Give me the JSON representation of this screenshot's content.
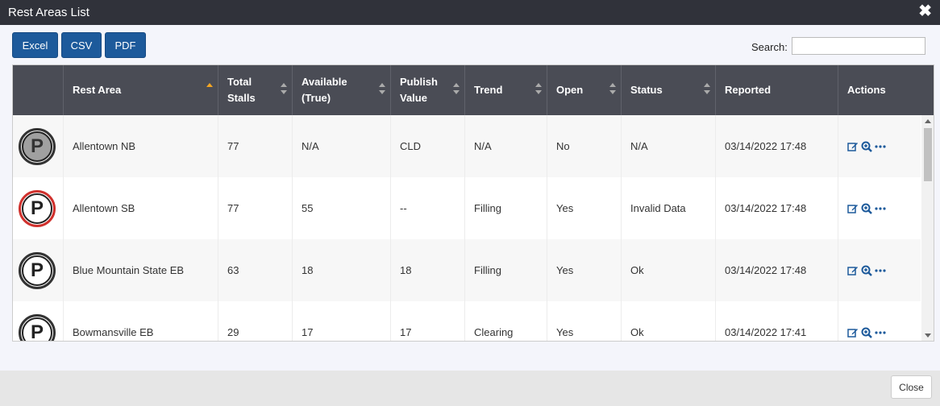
{
  "window": {
    "title": "Rest Areas List"
  },
  "toolbar": {
    "excel": "Excel",
    "csv": "CSV",
    "pdf": "PDF"
  },
  "search": {
    "label": "Search:",
    "value": ""
  },
  "table": {
    "headers": {
      "rest_area": "Rest Area",
      "total_stalls_1": "Total",
      "total_stalls_2": "Stalls",
      "available_1": "Available",
      "available_2": "(True)",
      "publish_1": "Publish",
      "publish_2": "Value",
      "trend": "Trend",
      "open": "Open",
      "status": "Status",
      "reported": "Reported",
      "actions": "Actions"
    },
    "sorted_column": "rest_area",
    "rows": [
      {
        "icon": "parking-closed-icon",
        "name": "Allentown NB",
        "total": "77",
        "available": "N/A",
        "publish": "CLD",
        "trend": "N/A",
        "open": "No",
        "status": "N/A",
        "reported": "03/14/2022 17:48"
      },
      {
        "icon": "parking-alert-icon",
        "name": "Allentown SB",
        "total": "77",
        "available": "55",
        "publish": "--",
        "trend": "Filling",
        "open": "Yes",
        "status": "Invalid Data",
        "reported": "03/14/2022 17:48"
      },
      {
        "icon": "parking-icon",
        "name": "Blue Mountain State EB",
        "total": "63",
        "available": "18",
        "publish": "18",
        "trend": "Filling",
        "open": "Yes",
        "status": "Ok",
        "reported": "03/14/2022 17:48"
      },
      {
        "icon": "parking-icon",
        "name": "Bowmansville EB",
        "total": "29",
        "available": "17",
        "publish": "17",
        "trend": "Clearing",
        "open": "Yes",
        "status": "Ok",
        "reported": "03/14/2022 17:41"
      }
    ]
  },
  "parking_letter": "P",
  "footer": {
    "close": "Close"
  },
  "colors": {
    "titlebar": "#30323a",
    "button": "#1d5a9b",
    "header": "#4a4c55",
    "accent": "#f5a623",
    "alert": "#d0312d",
    "icon_blue": "#1d5a9b"
  }
}
